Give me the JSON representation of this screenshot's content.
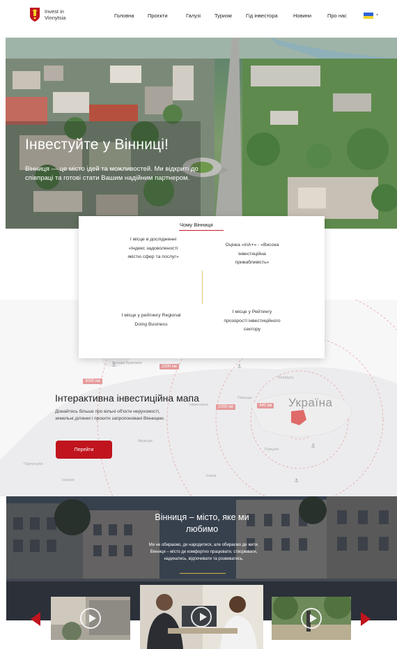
{
  "brand": {
    "name_line1": "Invest in",
    "name_line2": "Vinnytsia"
  },
  "nav": {
    "items": [
      {
        "label": "Головна"
      },
      {
        "label": "Проєкти"
      },
      {
        "label": "Галузі"
      },
      {
        "label": "Туризм"
      },
      {
        "label": "Гід інвестора"
      },
      {
        "label": "Новини"
      },
      {
        "label": "Про нас"
      }
    ],
    "language_icon": "ukraine-flag-icon"
  },
  "hero": {
    "title": "Інвестуйте у Вінниці!",
    "subtitle": "Вінниця — це місто ідей та можливостей. Ми відкриті до співпраці та готові стати Вашим надійним партнером."
  },
  "why": {
    "tab_label": "Чому Вінниця",
    "items": [
      {
        "text": "I місце в дослідженні «Індекс задоволеності якістю сфер та послуг»"
      },
      {
        "text": "Оцінка «iriA+» - «Висока інвестиційна привабливість»"
      },
      {
        "text": "I місце у рейтингу Regional Doing Business"
      },
      {
        "text": "I місце у Рейтингу прозорості інвестиційного сектору"
      }
    ]
  },
  "map": {
    "title": "Інтерактивна інвестиційна мапа",
    "description": "Дізнайтесь більше про вільні об'єкти нерухомості, земельні ділянки і проєкти запропоновані Вінницею.",
    "button_label": "Перейти",
    "country_label": "Україна",
    "distances": [
      "2000 км",
      "3000 км",
      "1000 км",
      "440 км"
    ],
    "countries": [
      "Велика Британія",
      "Польща",
      "Білорусь",
      "Румунія",
      "Португалія",
      "Іспанія",
      "Італія",
      "Франція",
      "Німеччина"
    ]
  },
  "city": {
    "title": "Вінниця – місто, яке ми любимо",
    "subtitle": "Ми не обираємо, де народитися, але обираємо де жити. Вінниця – місто де комфортно працювати, створювати, надихатись, відпочивати та розвиватись."
  },
  "colors": {
    "accent": "#c0141e",
    "gold": "#d2b04c",
    "flag_blue": "#2e64d6",
    "flag_yellow": "#f5d22a"
  }
}
